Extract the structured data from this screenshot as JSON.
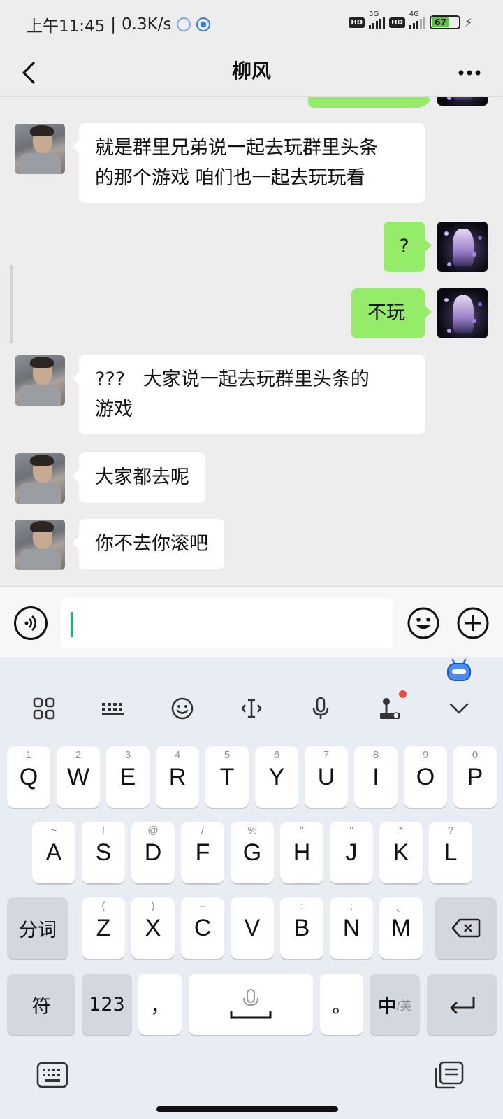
{
  "status_bar": {
    "time": "上午11:45",
    "speed": "0.3K/s",
    "hd_1": "HD",
    "net_1": "5G",
    "hd_2": "HD",
    "net_2": "4G",
    "battery": "67"
  },
  "nav": {
    "title": "柳风",
    "back_icon": "chevron-left-icon",
    "more_icon": "more-dots-icon"
  },
  "messages": [
    {
      "side": "left",
      "text_line1": "就是群里兄弟说一起去玩群里头条",
      "text_line2": "的那个游戏 咱们也一起去玩玩看"
    },
    {
      "side": "right",
      "text": "?"
    },
    {
      "side": "right",
      "text": "不玩"
    },
    {
      "side": "left",
      "text_line1": "???   大家说一起去玩群里头条的",
      "text_line2": "游戏"
    },
    {
      "side": "left",
      "text": "大家都去呢"
    },
    {
      "side": "left",
      "text": "你不去你滚吧"
    }
  ],
  "input": {
    "value": "",
    "voice_icon": "voice-icon",
    "emoji_icon": "emoji-icon",
    "plus_icon": "plus-icon"
  },
  "keyboard": {
    "toolbar": [
      "grid-icon",
      "keyboard-icon",
      "emoji-icon",
      "cursor-icon",
      "mic-icon",
      "joystick-icon",
      "chevron-down-icon"
    ],
    "row1": [
      {
        "main": "Q",
        "sub": "1"
      },
      {
        "main": "W",
        "sub": "2"
      },
      {
        "main": "E",
        "sub": "3"
      },
      {
        "main": "R",
        "sub": "4"
      },
      {
        "main": "T",
        "sub": "5"
      },
      {
        "main": "Y",
        "sub": "6"
      },
      {
        "main": "U",
        "sub": "7"
      },
      {
        "main": "I",
        "sub": "8"
      },
      {
        "main": "O",
        "sub": "9"
      },
      {
        "main": "P",
        "sub": "0"
      }
    ],
    "row2": [
      {
        "main": "A",
        "sub": "~"
      },
      {
        "main": "S",
        "sub": "!"
      },
      {
        "main": "D",
        "sub": "@"
      },
      {
        "main": "F",
        "sub": "/"
      },
      {
        "main": "G",
        "sub": "%"
      },
      {
        "main": "H",
        "sub": "\""
      },
      {
        "main": "J",
        "sub": "\""
      },
      {
        "main": "K",
        "sub": "*"
      },
      {
        "main": "L",
        "sub": "?"
      }
    ],
    "row3": [
      {
        "main": "Z",
        "sub": "("
      },
      {
        "main": "X",
        "sub": ")"
      },
      {
        "main": "C",
        "sub": "–"
      },
      {
        "main": "V",
        "sub": "_"
      },
      {
        "main": "B",
        "sub": ":"
      },
      {
        "main": "N",
        "sub": ";"
      },
      {
        "main": "M",
        "sub": "、"
      }
    ],
    "segment_key": "分词",
    "symbol_key": "符",
    "num_key": "123",
    "comma_key": "，",
    "period_key": "。",
    "lang_key_main": "中",
    "lang_key_sub": "/英"
  },
  "colors": {
    "bubble_right": "#95ec69",
    "bubble_left": "#ffffff",
    "cursor": "#07c160",
    "background": "#ededed"
  }
}
